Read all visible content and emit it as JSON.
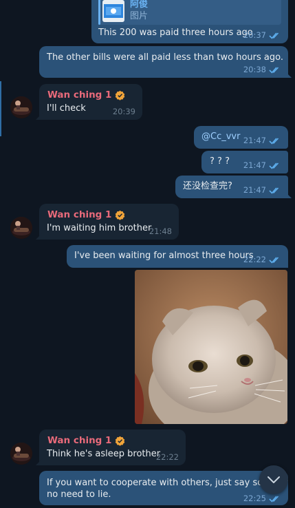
{
  "messages": {
    "m1": {
      "reply_title": "阿俊",
      "reply_subtitle": "图片",
      "text": "This 200 was paid three hours ago",
      "time": "20:37"
    },
    "m2": {
      "text": "The other bills were all paid less than two hours ago.",
      "time": "20:38"
    },
    "m3": {
      "sender": "Wan ching 1",
      "text": "I'll check",
      "time": "20:39"
    },
    "m4": {
      "text": "@Cc_vvr",
      "time": "21:47"
    },
    "m5": {
      "text": "? ? ?",
      "time": "21:47"
    },
    "m6": {
      "text": "还没检查完?",
      "time": "21:47"
    },
    "m7": {
      "sender": "Wan ching 1",
      "text": "I'm waiting him brother",
      "time": "21:48"
    },
    "m8": {
      "text": "I've been waiting for almost three hours",
      "time": "22:22"
    },
    "m9": {
      "sender": "Wan ching 1",
      "text": "Think he's asleep brother",
      "time": "22:22"
    },
    "m10": {
      "line1": "If you want to cooperate with others, just say so. There's",
      "line2": "no need to lie.",
      "time": "22:25"
    }
  },
  "colors": {
    "background": "#0e1621",
    "outgoing_bubble": "#2b5278",
    "incoming_bubble": "#182533",
    "sender_name": "#e86a7a",
    "read_ticks": "#5fb0f0",
    "verified_badge": "#f0a43a"
  },
  "icons": {
    "read": "double-check-icon",
    "verified": "verified-badge-icon",
    "scroll": "chevron-down-icon"
  }
}
